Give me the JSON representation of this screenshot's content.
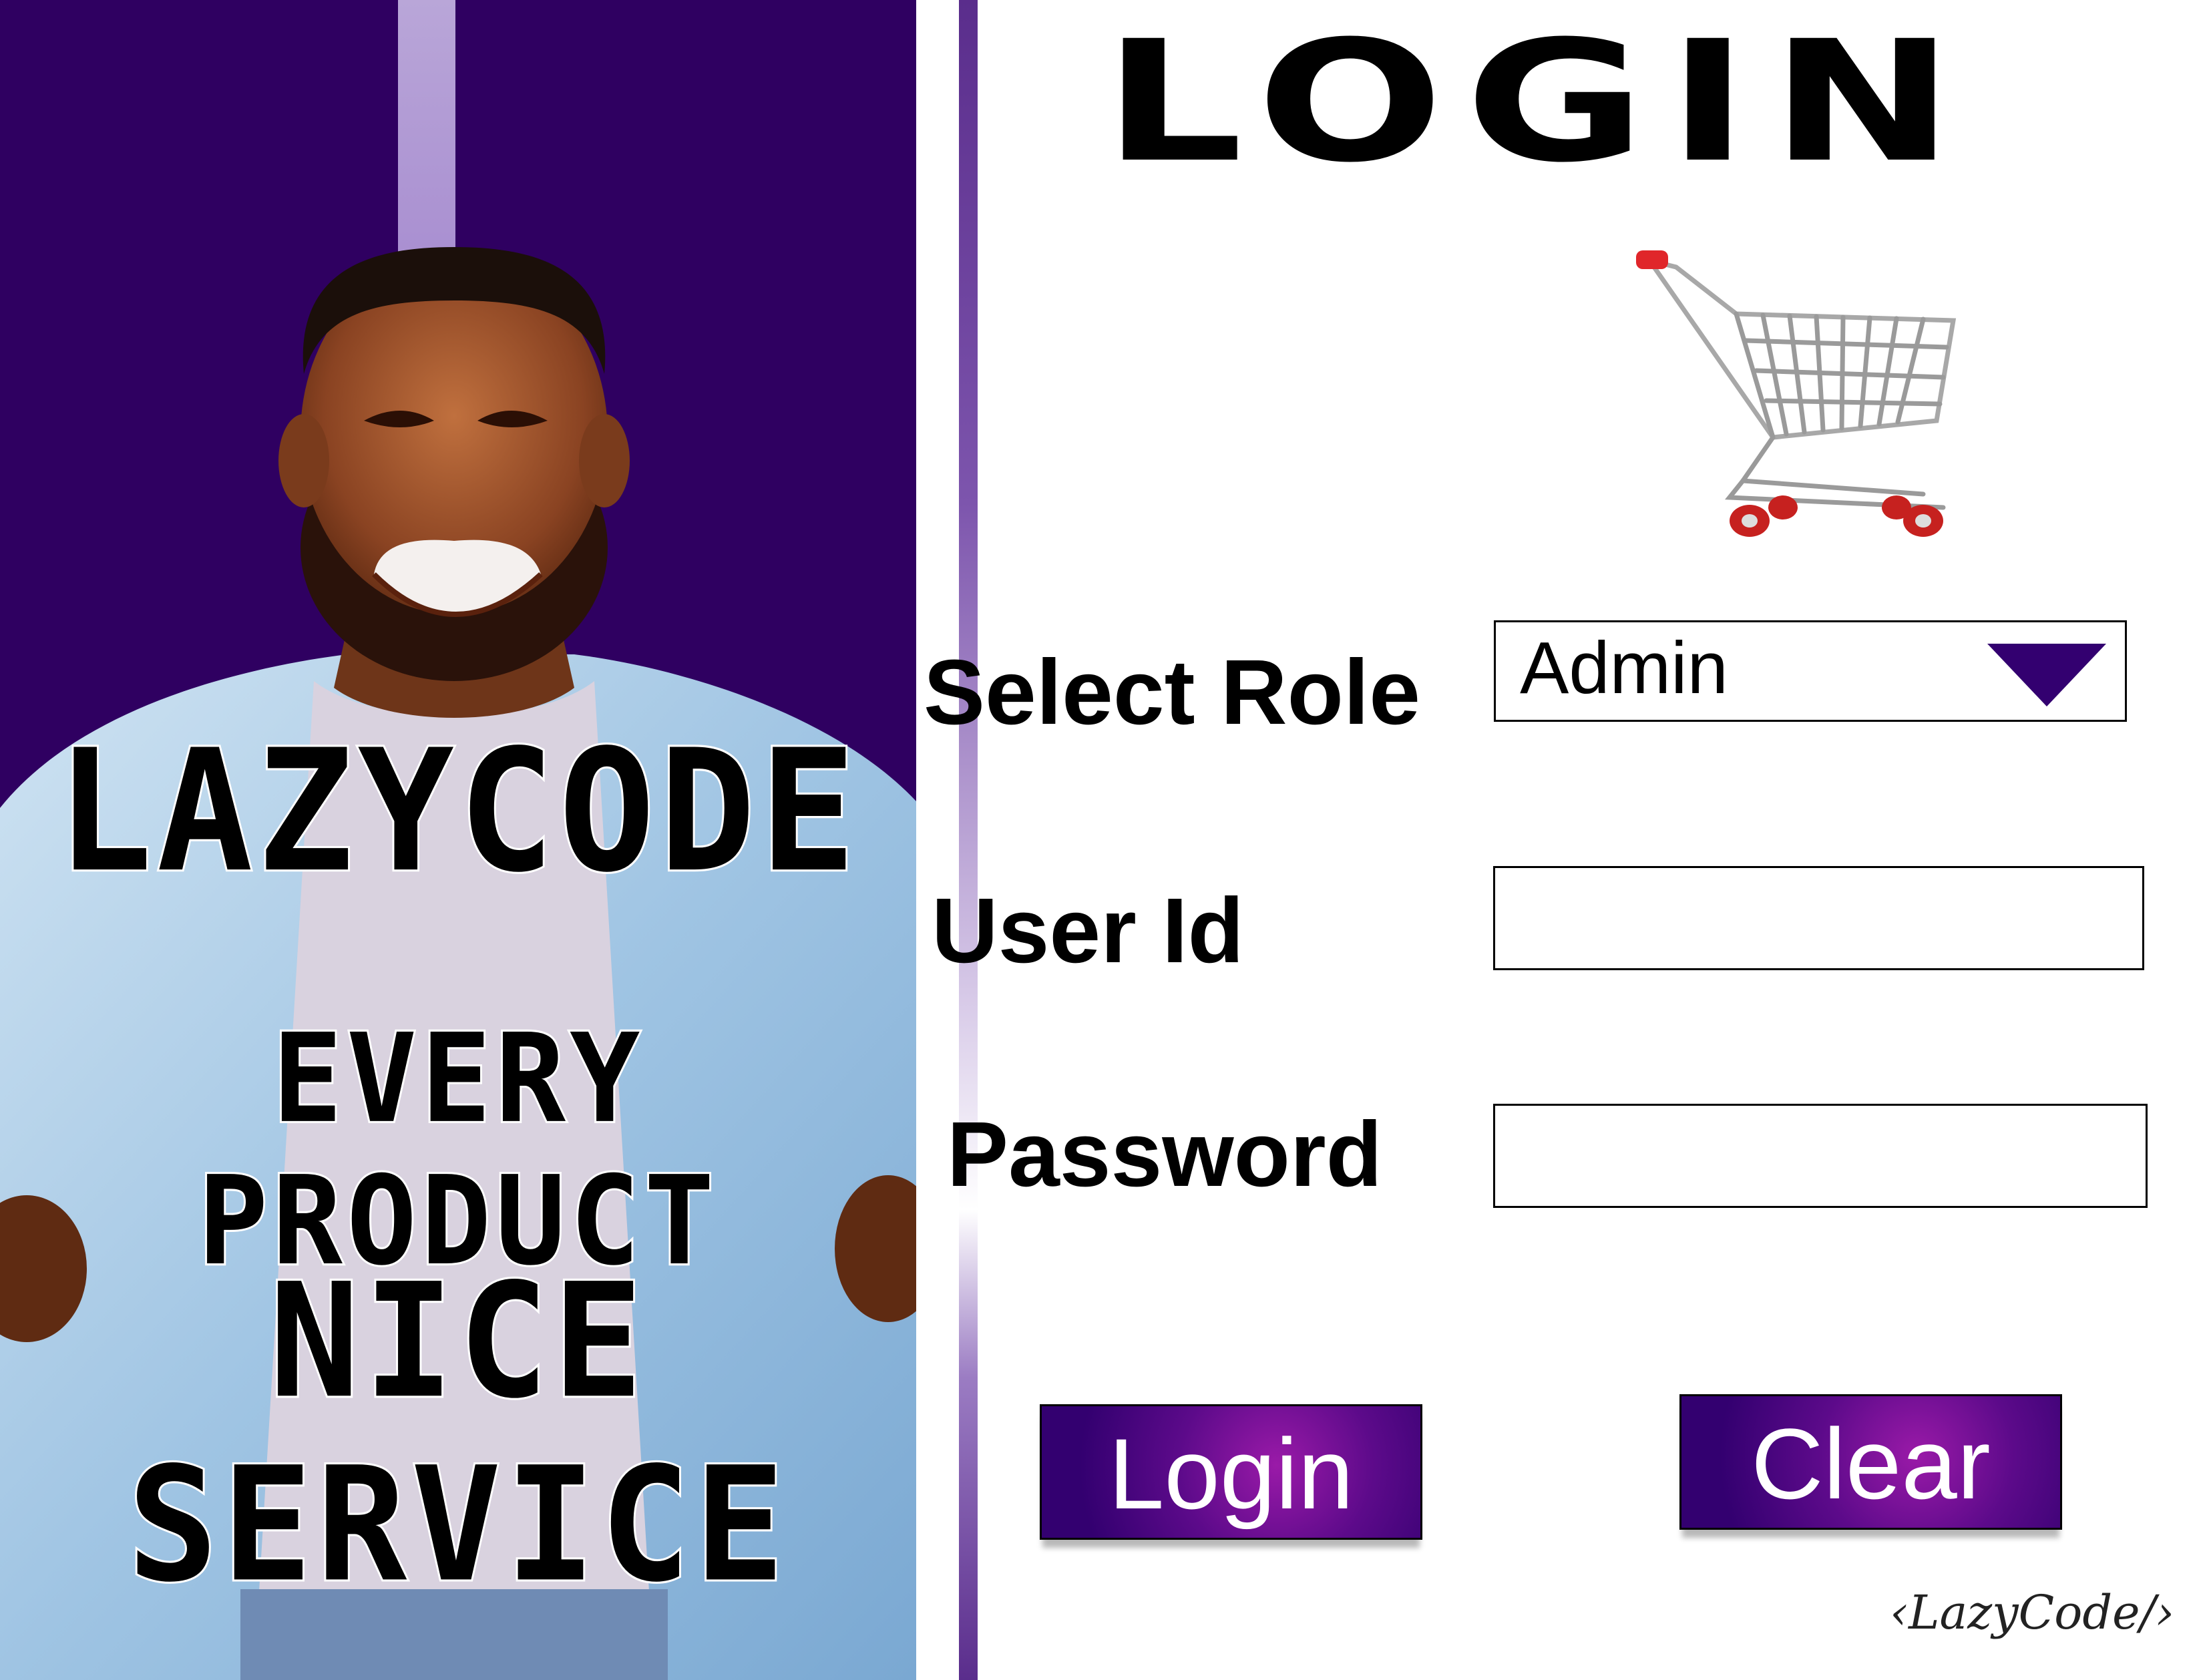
{
  "promo": {
    "brand": "LAZYCODE",
    "tagline_1": "EVERY PRODUCT",
    "tagline_2": "NICE SERVICE"
  },
  "login": {
    "title": "LOGIN",
    "role_label": "Select Role",
    "role_value": "Admin",
    "user_label": "User Id",
    "user_value": "",
    "password_label": "Password",
    "password_value": "",
    "login_button": "Login",
    "clear_button": "Clear"
  },
  "signature": "‹LazyCode/›",
  "colors": {
    "panel": "#2f0061",
    "accent": "#330070",
    "button_glow": "#9a1aa8"
  }
}
